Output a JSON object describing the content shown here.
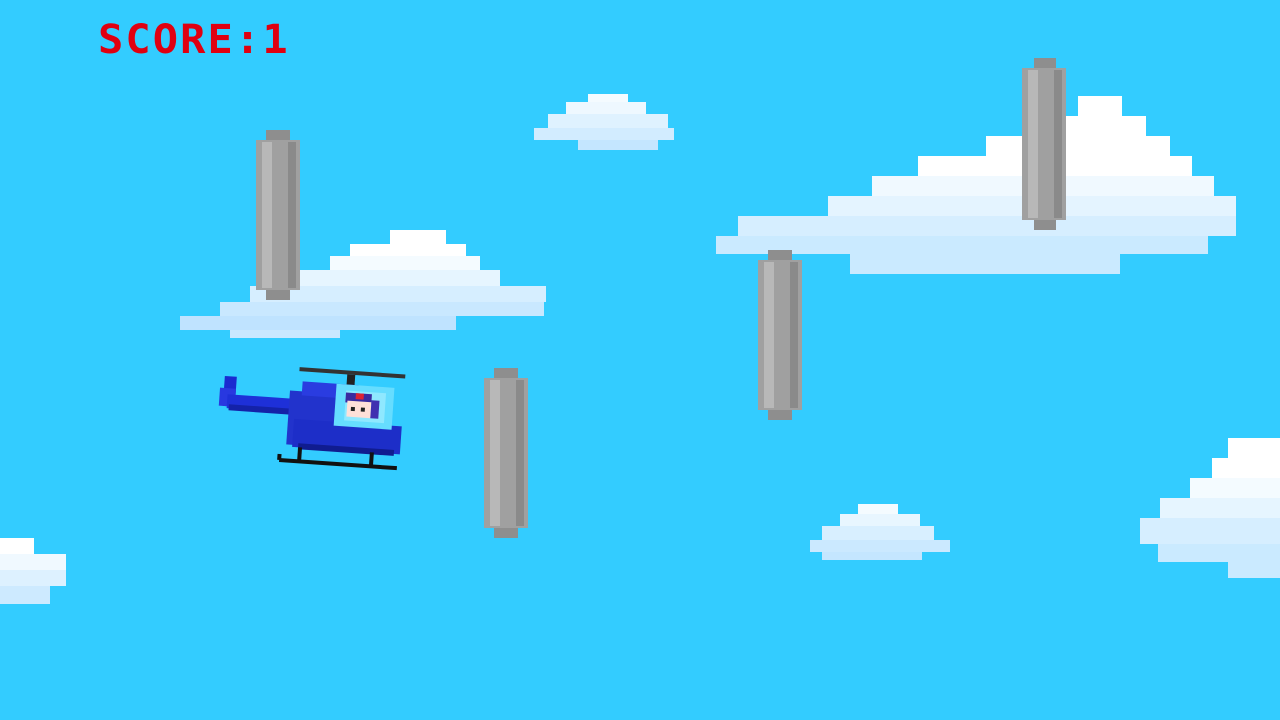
{
  "hud": {
    "score_text": "SCORE:1",
    "score_color": "#e00010"
  },
  "colors": {
    "sky": "#33ccff",
    "pipe": "#a6a6a6",
    "helicopter": "#2233cc"
  },
  "scene": {
    "player": {
      "name": "helicopter",
      "pilot": "pilot-head"
    },
    "obstacles": [
      "gray-pipe",
      "gray-pipe",
      "gray-pipe",
      "gray-pipe"
    ],
    "clouds": 7
  }
}
